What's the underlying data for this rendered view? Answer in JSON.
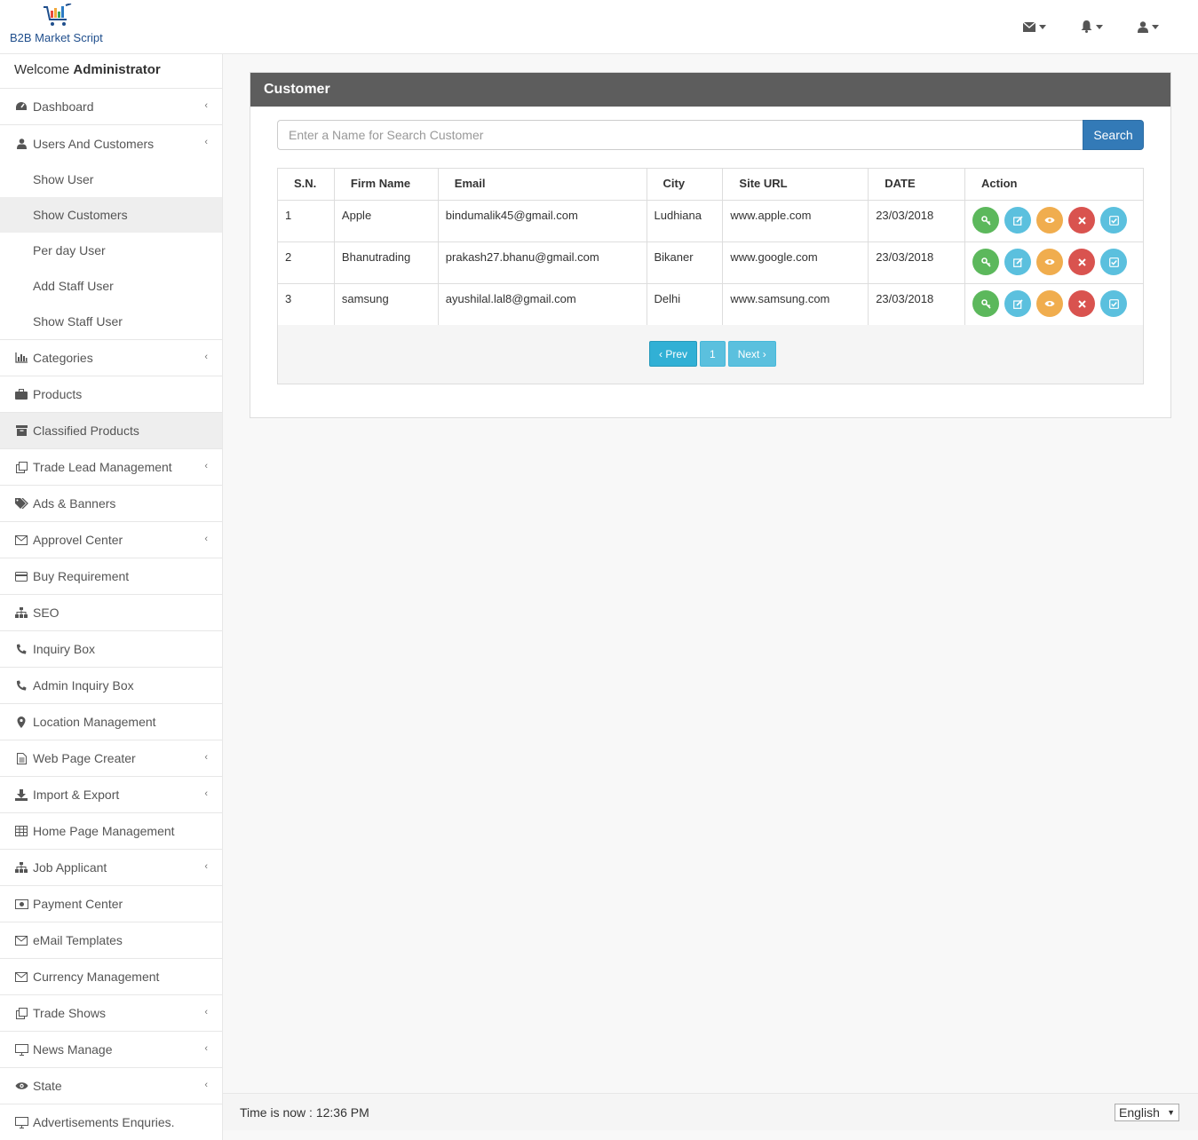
{
  "brand": {
    "name": "B2B Market Script"
  },
  "sidebar": {
    "welcome_prefix": "Welcome",
    "welcome_user": "Administrator",
    "items": [
      {
        "label": "Dashboard",
        "icon": "dashboard-icon",
        "chevron": true
      },
      {
        "label": "Users And Customers",
        "icon": "user-icon",
        "chevron": true
      },
      {
        "label": "Categories",
        "icon": "bar-chart-icon",
        "chevron": true
      },
      {
        "label": "Products",
        "icon": "briefcase-icon",
        "chevron": false
      },
      {
        "label": "Classified Products",
        "icon": "archive-icon",
        "chevron": false
      },
      {
        "label": "Trade Lead Management",
        "icon": "clone-icon",
        "chevron": true
      },
      {
        "label": "Ads & Banners",
        "icon": "tags-icon",
        "chevron": false
      },
      {
        "label": "Approvel Center",
        "icon": "envelope-icon",
        "chevron": true
      },
      {
        "label": "Buy Requirement",
        "icon": "credit-card-icon",
        "chevron": false
      },
      {
        "label": "SEO",
        "icon": "sitemap-icon",
        "chevron": false
      },
      {
        "label": "Inquiry Box",
        "icon": "phone-icon",
        "chevron": false
      },
      {
        "label": "Admin Inquiry Box",
        "icon": "phone-icon",
        "chevron": false
      },
      {
        "label": "Location Management",
        "icon": "map-marker-icon",
        "chevron": false
      },
      {
        "label": "Web Page Creater",
        "icon": "file-text-icon",
        "chevron": true
      },
      {
        "label": "Import & Export",
        "icon": "download-icon",
        "chevron": true
      },
      {
        "label": "Home Page Management",
        "icon": "table-icon",
        "chevron": false
      },
      {
        "label": "Job Applicant",
        "icon": "sitemap-icon",
        "chevron": true
      },
      {
        "label": "Payment Center",
        "icon": "money-icon",
        "chevron": false
      },
      {
        "label": "eMail Templates",
        "icon": "envelope-icon",
        "chevron": false
      },
      {
        "label": "Currency Management",
        "icon": "envelope-icon",
        "chevron": false
      },
      {
        "label": "Trade Shows",
        "icon": "clone-icon",
        "chevron": true
      },
      {
        "label": "News Manage",
        "icon": "desktop-icon",
        "chevron": true
      },
      {
        "label": "State",
        "icon": "eye-icon",
        "chevron": true
      },
      {
        "label": "Advertisements Enquries.",
        "icon": "desktop-icon",
        "chevron": false
      }
    ],
    "sub_items": [
      {
        "label": "Show User"
      },
      {
        "label": "Show Customers"
      },
      {
        "label": "Per day User"
      },
      {
        "label": "Add Staff User"
      },
      {
        "label": "Show Staff User"
      }
    ]
  },
  "panel": {
    "title": "Customer",
    "search_placeholder": "Enter a Name for Search Customer",
    "search_button": "Search"
  },
  "table": {
    "headers": [
      "S.N.",
      "Firm Name",
      "Email",
      "City",
      "Site URL",
      "DATE",
      "Action"
    ],
    "rows": [
      [
        "1",
        "Apple",
        "bindumalik45@gmail.com",
        "Ludhiana",
        "www.apple.com",
        "23/03/2018"
      ],
      [
        "2",
        "Bhanutrading",
        "prakash27.bhanu@gmail.com",
        "Bikaner",
        "www.google.com",
        "23/03/2018"
      ],
      [
        "3",
        "samsung",
        "ayushilal.lal8@gmail.com",
        "Delhi",
        "www.samsung.com",
        "23/03/2018"
      ]
    ]
  },
  "pagination": {
    "prev": "‹ Prev",
    "page": "1",
    "next": "Next ›"
  },
  "footer": {
    "time": "Time is now : 12:36 PM",
    "language": "English"
  },
  "colors": {
    "accent": "#337ab7",
    "header": "#5d5d5d",
    "green": "#5cb85c",
    "blue": "#5bc0de",
    "orange": "#f0ad4e",
    "red": "#d9534f"
  }
}
